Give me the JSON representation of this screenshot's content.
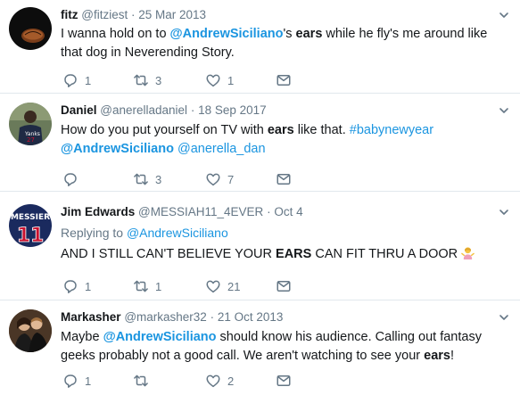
{
  "tweets": [
    {
      "name": "fitz",
      "handle": "@fitziest",
      "date": "25 Mar 2013",
      "text_1": "I wanna hold on to ",
      "mention_1": "@AndrewSiciliano",
      "text_2": "'s ",
      "highlight_1": "ears",
      "text_3": " while he fly's me around like that dog in Neverending Story.",
      "replies": "1",
      "retweets": "3",
      "likes": "1"
    },
    {
      "name": "Daniel",
      "handle": "@anerelladaniel",
      "date": "18 Sep 2017",
      "text_1": "How do you put yourself on TV with ",
      "highlight_1": "ears",
      "text_2": " like that. ",
      "hashtag": "#babynewyear",
      "mention_1": "@AndrewSiciliano",
      "mention_2": "@anerella_dan",
      "replies": "",
      "retweets": "3",
      "likes": "7"
    },
    {
      "name": "Jim Edwards",
      "handle": "@MESSIAH11_4EVER",
      "date": "Oct 4",
      "replying_label": "Replying to ",
      "replying_to": "@AndrewSiciliano",
      "text_1": "AND I STILL CAN'T BELIEVE YOUR ",
      "highlight_1": "EARS",
      "text_2": " CAN FIT THRU A DOOR",
      "replies": "1",
      "retweets": "1",
      "likes": "21"
    },
    {
      "name": "Markasher",
      "handle": "@markasher32",
      "date": "21 Oct 2013",
      "text_1": "Maybe ",
      "mention_1": "@AndrewSiciliano",
      "text_2": " should know his audience. Calling out fantasy geeks probably not a good call. We aren't watching to see your ",
      "highlight_1": "ears",
      "text_3": "!",
      "replies": "1",
      "retweets": "",
      "likes": "2"
    }
  ],
  "separator": "·",
  "jersey_text": "MESSIER",
  "jersey_number": "11",
  "colors": {
    "link": "#1b95e0",
    "muted": "#657786",
    "text": "#14171a",
    "divider": "#e1e8ed"
  },
  "icons": [
    "reply-icon",
    "retweet-icon",
    "like-icon",
    "message-icon",
    "chevron-down-icon"
  ]
}
